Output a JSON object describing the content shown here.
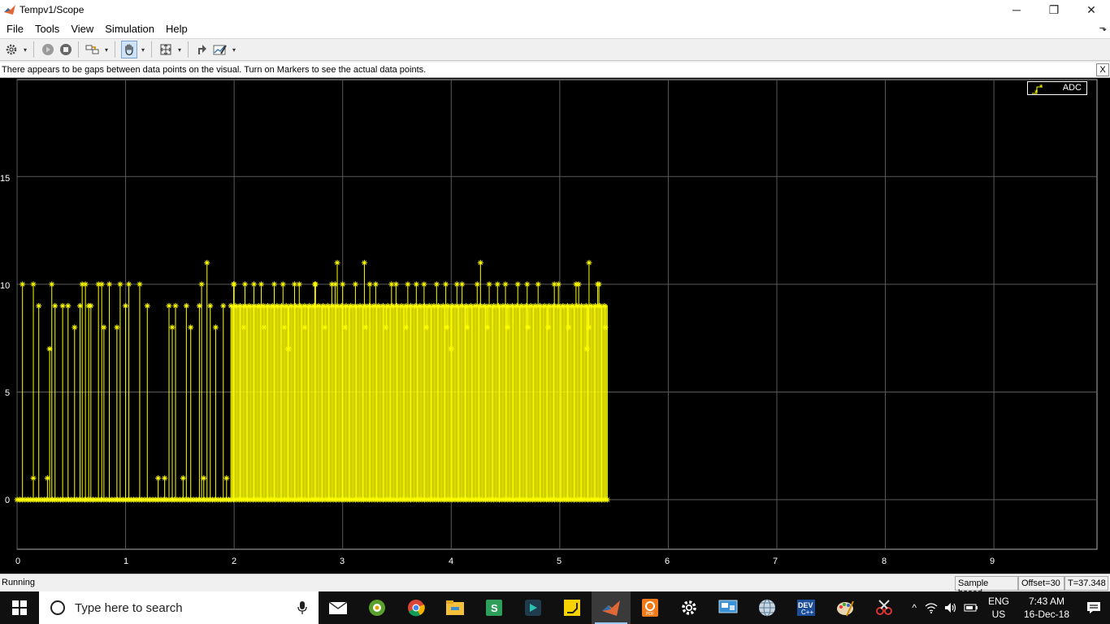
{
  "window": {
    "title": "Tempv1/Scope",
    "minimize_glyph": "─",
    "restore_glyph": "❐",
    "close_glyph": "✕"
  },
  "menu": [
    "File",
    "Tools",
    "View",
    "Simulation",
    "Help"
  ],
  "dock_glyph": "⬎",
  "toolbar": {
    "icons": [
      "gear-icon",
      "run-icon",
      "stop-icon",
      "signal-selector-icon",
      "pan-hand-icon",
      "zoom-fit-icon",
      "highlight-block-icon",
      "data-cursor-icon"
    ],
    "pressed": "pan-hand-icon"
  },
  "infobar": {
    "message": "There appears to be gaps between data points on the visual. Turn on Markers to see the actual data points.",
    "close_label": "X"
  },
  "chart_data": {
    "type": "line",
    "title": "",
    "xlabel": "",
    "ylabel": "",
    "xlim": [
      0,
      9.95
    ],
    "ylim": [
      -2.3,
      19.5
    ],
    "xticks": [
      "0",
      "1",
      "2",
      "3",
      "4",
      "5",
      "6",
      "7",
      "8",
      "9"
    ],
    "yticks": [
      "0",
      "5",
      "10",
      "15"
    ],
    "grid": true,
    "legend_position": "top-right",
    "background": "#000000",
    "series": [
      {
        "name": "ADC",
        "color": "#ffff00",
        "marker": "asterisk",
        "sparse_spikes": [
          {
            "x": 0.05,
            "y": 10
          },
          {
            "x": 0.15,
            "y": 10
          },
          {
            "x": 0.15,
            "y": 1
          },
          {
            "x": 0.2,
            "y": 9
          },
          {
            "x": 0.28,
            "y": 1
          },
          {
            "x": 0.3,
            "y": 7
          },
          {
            "x": 0.32,
            "y": 10
          },
          {
            "x": 0.35,
            "y": 9
          },
          {
            "x": 0.42,
            "y": 9
          },
          {
            "x": 0.47,
            "y": 9
          },
          {
            "x": 0.53,
            "y": 8
          },
          {
            "x": 0.58,
            "y": 9
          },
          {
            "x": 0.6,
            "y": 10
          },
          {
            "x": 0.63,
            "y": 10
          },
          {
            "x": 0.66,
            "y": 9
          },
          {
            "x": 0.68,
            "y": 9
          },
          {
            "x": 0.75,
            "y": 10
          },
          {
            "x": 0.78,
            "y": 10
          },
          {
            "x": 0.8,
            "y": 8
          },
          {
            "x": 0.85,
            "y": 10
          },
          {
            "x": 0.92,
            "y": 8
          },
          {
            "x": 0.95,
            "y": 10
          },
          {
            "x": 1.0,
            "y": 9
          },
          {
            "x": 1.03,
            "y": 10
          },
          {
            "x": 1.13,
            "y": 10
          },
          {
            "x": 1.2,
            "y": 9
          },
          {
            "x": 1.3,
            "y": 1
          },
          {
            "x": 1.36,
            "y": 1
          },
          {
            "x": 1.4,
            "y": 9
          },
          {
            "x": 1.43,
            "y": 8
          },
          {
            "x": 1.46,
            "y": 9
          },
          {
            "x": 1.53,
            "y": 1
          },
          {
            "x": 1.56,
            "y": 9
          },
          {
            "x": 1.6,
            "y": 8
          },
          {
            "x": 1.68,
            "y": 9
          },
          {
            "x": 1.7,
            "y": 10
          },
          {
            "x": 1.72,
            "y": 1
          },
          {
            "x": 1.75,
            "y": 11
          },
          {
            "x": 1.78,
            "y": 9
          },
          {
            "x": 1.83,
            "y": 8
          },
          {
            "x": 1.9,
            "y": 9
          },
          {
            "x": 1.93,
            "y": 1
          }
        ],
        "dense_region": {
          "x_start": 1.97,
          "x_end": 5.44,
          "base": 0,
          "main_level": 9,
          "secondary_levels": [
            8,
            10
          ]
        },
        "dense_peaks": [
          {
            "x": 2.95,
            "y": 11
          },
          {
            "x": 3.2,
            "y": 11
          },
          {
            "x": 4.27,
            "y": 11
          },
          {
            "x": 5.27,
            "y": 11
          },
          {
            "x": 2.0,
            "y": 10
          },
          {
            "x": 2.1,
            "y": 10
          },
          {
            "x": 2.25,
            "y": 10
          },
          {
            "x": 2.45,
            "y": 10
          },
          {
            "x": 2.6,
            "y": 10
          },
          {
            "x": 2.75,
            "y": 10
          },
          {
            "x": 2.9,
            "y": 10
          },
          {
            "x": 3.0,
            "y": 10
          },
          {
            "x": 3.25,
            "y": 10
          },
          {
            "x": 3.45,
            "y": 10
          },
          {
            "x": 3.6,
            "y": 10
          },
          {
            "x": 3.75,
            "y": 10
          },
          {
            "x": 3.95,
            "y": 10
          },
          {
            "x": 4.1,
            "y": 10
          },
          {
            "x": 4.35,
            "y": 10
          },
          {
            "x": 4.5,
            "y": 10
          },
          {
            "x": 4.7,
            "y": 10
          },
          {
            "x": 4.95,
            "y": 10
          },
          {
            "x": 5.15,
            "y": 10
          },
          {
            "x": 5.35,
            "y": 10
          },
          {
            "x": 5.42,
            "y": 8
          },
          {
            "x": 2.5,
            "y": 7
          },
          {
            "x": 4.0,
            "y": 7
          },
          {
            "x": 5.25,
            "y": 7
          }
        ]
      }
    ]
  },
  "status": {
    "state": "Running",
    "mode": "Sample based",
    "offset": "Offset=30",
    "time": "T=37.348"
  },
  "taskbar": {
    "search_placeholder": "Type here to search",
    "apps": [
      "mail-icon",
      "file-manager-icon",
      "chrome-icon",
      "explorer-icon",
      "sheets-icon",
      "film-editor-icon",
      "sticky-notes-icon",
      "matlab-icon",
      "pdf-app-icon",
      "settings-icon",
      "remote-desktop-icon",
      "network-globe-icon",
      "devcpp-icon",
      "paint-icon",
      "snipping-icon"
    ],
    "active_app": "matlab-icon",
    "language_top": "ENG",
    "language_bottom": "US",
    "time": "7:43 AM",
    "date": "16-Dec-18"
  }
}
